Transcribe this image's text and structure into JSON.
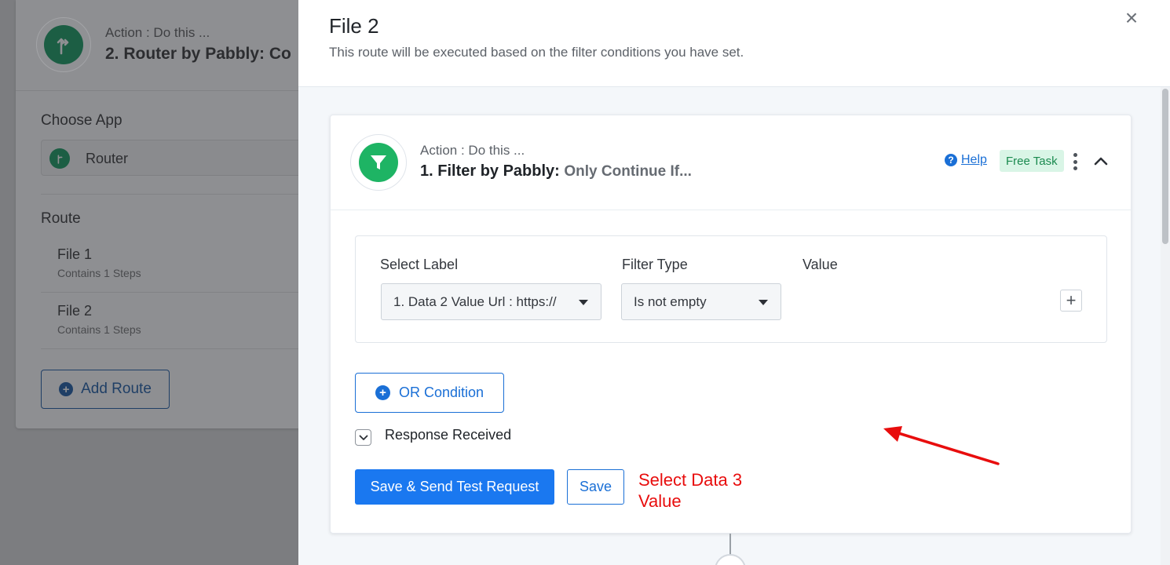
{
  "background_panel": {
    "action_label": "Action : Do this ...",
    "title": "2. Router by Pabbly: Co",
    "choose_app_label": "Choose App",
    "app_name": "Router",
    "route_label": "Route",
    "routes": [
      {
        "name": "File 1",
        "steps": "Contains 1 Steps"
      },
      {
        "name": "File 2",
        "steps": "Contains 1 Steps"
      }
    ],
    "add_route_label": "Add Route"
  },
  "drawer": {
    "title": "File 2",
    "subtitle": "This route will be executed based on the filter conditions you have set.",
    "close_glyph": "×"
  },
  "card": {
    "action_label": "Action : Do this ...",
    "title_bold": "1. Filter by Pabbly:",
    "title_muted": "Only Continue If...",
    "help_label": "Help",
    "badge_label": "Free Task"
  },
  "filter": {
    "select_label_heading": "Select Label",
    "filter_type_heading": "Filter Type",
    "value_heading": "Value",
    "selected_label": "1. Data 2 Value Url : https://",
    "selected_filter_type": "Is not empty"
  },
  "or_condition_label": "OR Condition",
  "response_received_label": "Response Received",
  "buttons": {
    "save_send": "Save & Send Test Request",
    "save": "Save"
  },
  "annotation": {
    "line1": "Select Data 3",
    "line2": "Value",
    "color": "#e80d0d"
  },
  "colors": {
    "accent": "#1a78f0",
    "filter_green": "#1eb464",
    "badge_bg": "#d9f5e6"
  },
  "icons": {
    "router": "router-icon",
    "filter": "funnel-icon",
    "help": "question-circle-icon",
    "close": "close-icon",
    "more": "kebab-icon",
    "collapse": "chevron-up-icon",
    "expand": "chevron-down-icon",
    "add": "plus-icon"
  }
}
